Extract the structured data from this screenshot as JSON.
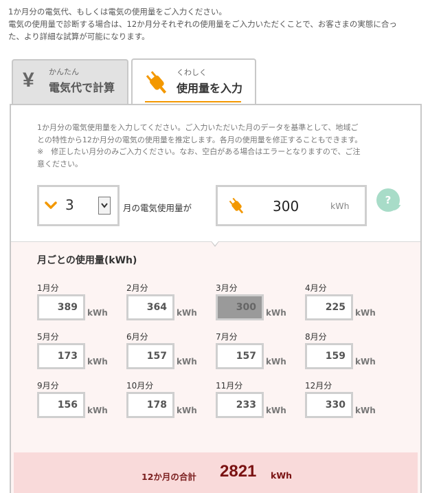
{
  "intro": {
    "line1": "1か月分の電気代、もしくは電気の使用量をご入力ください。",
    "line2": "電気の使用量で診断する場合は、12か月分それぞれの使用量をご入力いただくことで、お客さまの実態に合っ",
    "line3": "た、より詳細な試算が可能になります。"
  },
  "tabs": [
    {
      "small": "かんたん",
      "label": "電気代で計算",
      "icon": "yen-icon",
      "active": false
    },
    {
      "small": "くわしく",
      "label": "使用量を入力",
      "icon": "plug-icon",
      "active": true
    }
  ],
  "panel": {
    "desc1": "1か月分の電気使用量を入力してください。ご入力いただいた月のデータを基準として、地域ご",
    "desc2": "との特性から12か月分の電気の使用量を推定します。各月の使用量を修正することもできます。",
    "desc3": "※　修正したい月分のみご入力ください。なお、空白がある場合はエラーとなりますので、ご注",
    "desc4": "意ください。",
    "month_value": "3",
    "month_suffix": "月の電気使用量が",
    "usage_value": "300",
    "usage_unit": "kWh",
    "help_label": "?"
  },
  "monthly": {
    "title": "月ごとの使用量(kWh)",
    "unit": "kWh",
    "months": [
      {
        "label": "1月分",
        "value": "389"
      },
      {
        "label": "2月分",
        "value": "364"
      },
      {
        "label": "3月分",
        "value": "300"
      },
      {
        "label": "4月分",
        "value": "225"
      },
      {
        "label": "5月分",
        "value": "173"
      },
      {
        "label": "6月分",
        "value": "157"
      },
      {
        "label": "7月分",
        "value": "157"
      },
      {
        "label": "8月分",
        "value": "159"
      },
      {
        "label": "9月分",
        "value": "156"
      },
      {
        "label": "10月分",
        "value": "178"
      },
      {
        "label": "11月分",
        "value": "233"
      },
      {
        "label": "12月分",
        "value": "330"
      }
    ]
  },
  "total": {
    "label": "12か月の合計",
    "value": "2821",
    "unit": "kWh"
  },
  "colors": {
    "accent": "#f39800",
    "total_text": "#7a1212",
    "total_bg": "#f9dada",
    "help_bg": "#a8dcc8"
  }
}
